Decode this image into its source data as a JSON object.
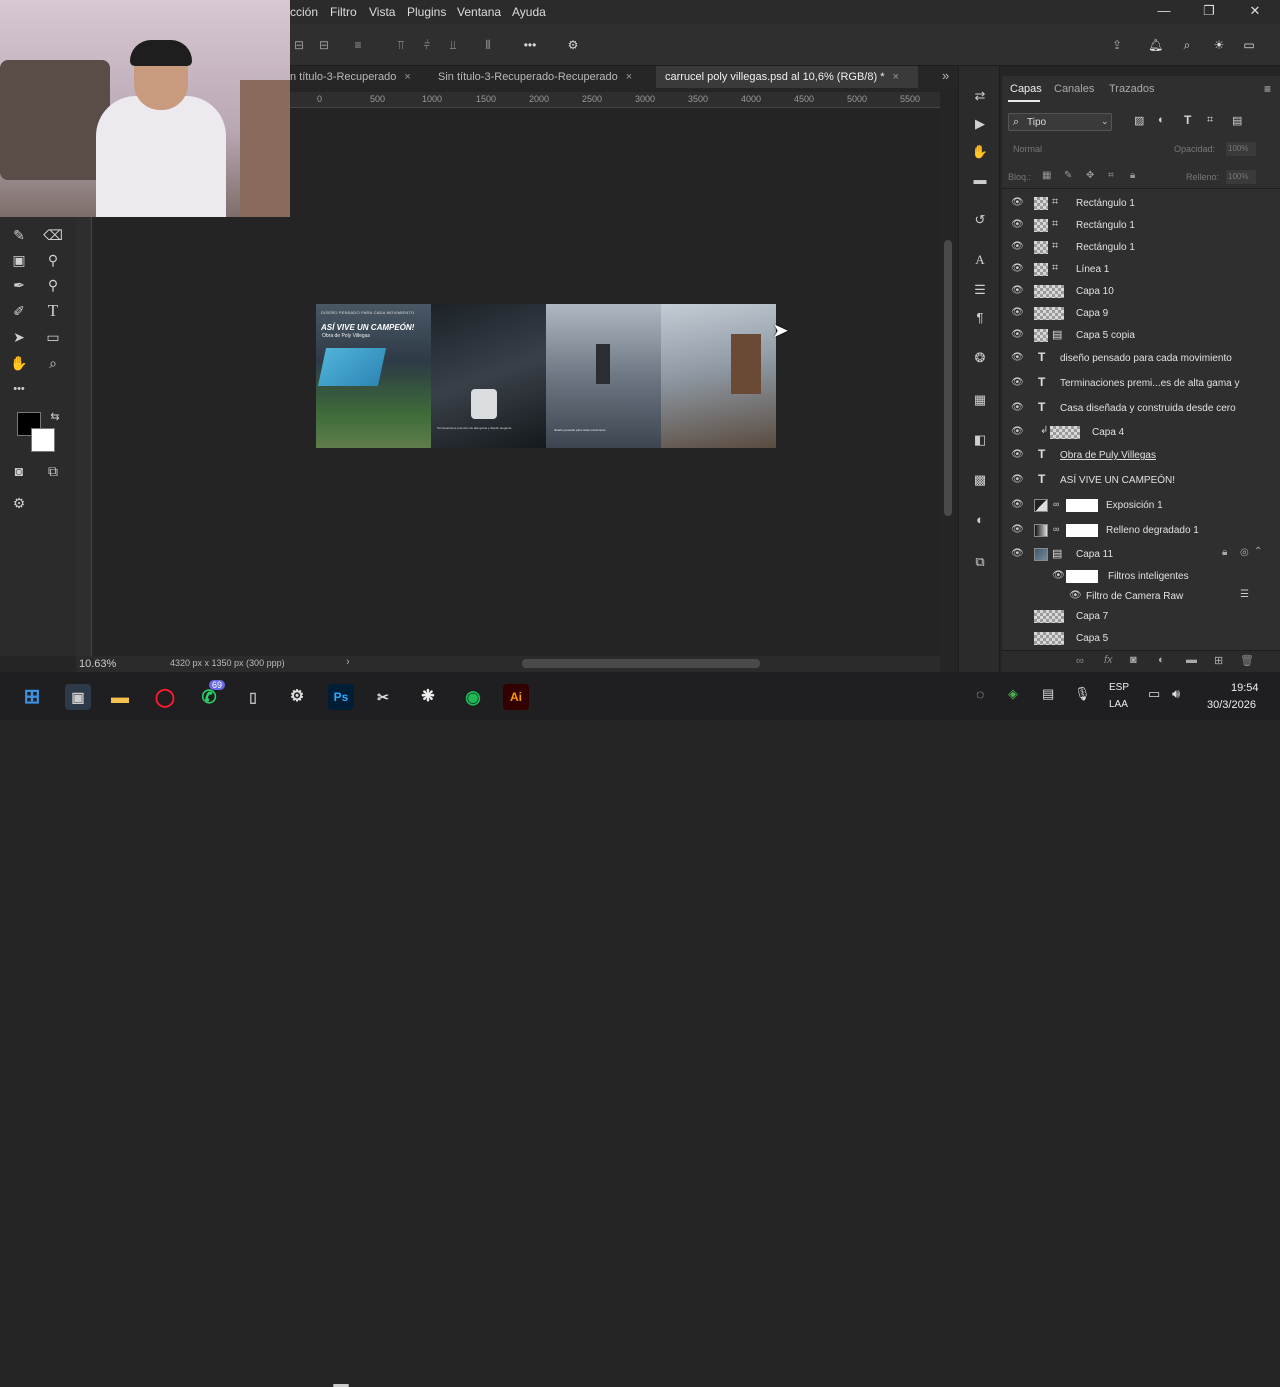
{
  "menu": [
    "cción",
    "Filtro",
    "Vista",
    "Plugins",
    "Ventana",
    "Ayuda"
  ],
  "tabs": [
    {
      "label": "n título-3-Recuperado",
      "active": false
    },
    {
      "label": "Sin título-3-Recuperado-Recuperado",
      "active": false
    },
    {
      "label": "carrucel poly villegas.psd al 10,6% (RGB/8) *",
      "active": true
    }
  ],
  "tab_more": "»",
  "ruler_marks": [
    "0",
    "500",
    "1000",
    "1500",
    "2000",
    "2500",
    "3000",
    "3500",
    "4000",
    "4500",
    "5000",
    "5500"
  ],
  "artboard": {
    "headline_small": "DISEÑO PENSADO PARA CADA MOVIMIENTO",
    "headline": "ASÍ VIVE UN CAMPEÓN!",
    "subheadline": "Obra de Poly Villegas",
    "caption_1": "Terminaciones premium de alta gama y diseño elegante",
    "caption_2": "diseño pensado para cada movimiento"
  },
  "status": {
    "zoom": "10.63%",
    "doc_size": "4320 px x 1350 px (300 ppp)"
  },
  "panel": {
    "tabs": [
      "Capas",
      "Canales",
      "Trazados"
    ],
    "filter_label": "Tipo",
    "blend_mode": "Normal",
    "opacity_label": "Opacidad:",
    "opacity_value": "100%",
    "lock_label": "Bloq.:",
    "fill_label": "Relleno:",
    "fill_value": "100%"
  },
  "layers": [
    {
      "name": "Rectángulo 1",
      "kind": "shape",
      "visible": true
    },
    {
      "name": "Rectángulo 1",
      "kind": "shape",
      "visible": true
    },
    {
      "name": "Rectángulo 1",
      "kind": "shape",
      "visible": true
    },
    {
      "name": "Línea 1",
      "kind": "shape",
      "visible": true
    },
    {
      "name": "Capa 10",
      "kind": "pixel",
      "visible": true
    },
    {
      "name": "Capa 9",
      "kind": "pixel",
      "visible": true
    },
    {
      "name": "Capa 5 copia",
      "kind": "smart",
      "visible": true
    },
    {
      "name": "diseño pensado para cada movimiento",
      "kind": "text",
      "visible": true
    },
    {
      "name": "Terminaciones premi...es de alta gama y",
      "kind": "text",
      "visible": true
    },
    {
      "name": "Casa diseñada y construida desde cero",
      "kind": "text",
      "visible": true
    },
    {
      "name": "Capa 4",
      "kind": "clipped",
      "visible": true
    },
    {
      "name": "Obra de Puly Villegas",
      "kind": "text",
      "visible": true
    },
    {
      "name": "ASÍ VIVE UN CAMPEÓN!",
      "kind": "text",
      "visible": true
    },
    {
      "name": "Exposición 1",
      "kind": "adjustment",
      "visible": true
    },
    {
      "name": "Relleno degradado 1",
      "kind": "gradient",
      "visible": true
    },
    {
      "name": "Capa 11",
      "kind": "smart-locked",
      "visible": true
    },
    {
      "name": "Filtros inteligentes",
      "kind": "filter-group",
      "visible": true
    },
    {
      "name": "Filtro de Camera Raw",
      "kind": "filter",
      "visible": true
    },
    {
      "name": "Capa 7",
      "kind": "pixel",
      "visible": false
    },
    {
      "name": "Capa 5",
      "kind": "pixel",
      "visible": false
    }
  ],
  "taskbar": {
    "whatsapp_badge": "69",
    "lang": "ESP",
    "layout": "LAA",
    "time": "19:54",
    "date": "30/3/2026"
  },
  "colors": {
    "accent": "#3d8fe0",
    "photoshop": "#31a8ff",
    "illustrator": "#ff9a00"
  }
}
